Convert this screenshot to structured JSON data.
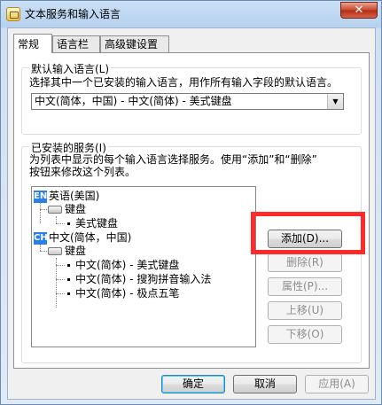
{
  "window": {
    "title": "文本服务和输入语言",
    "close_glyph": "✕"
  },
  "tabs": [
    {
      "label": "常规"
    },
    {
      "label": "语言栏"
    },
    {
      "label": "高级键设置"
    }
  ],
  "default_language": {
    "title": "默认输入语言(L)",
    "description": "选择其中一个已安装的输入语言，用作所有输入字段的默认语言。",
    "selected": "中文(简体，中国) - 中文(简体) - 美式键盘"
  },
  "installed_services": {
    "title": "已安装的服务(I)",
    "description_line1": "为列表中显示的每个输入语言选择服务。使用“添加”和“删除”",
    "description_line2": "按钮来修改这个列表。",
    "tree": {
      "lang1": {
        "badge": "EN",
        "label": "英语(美国)"
      },
      "lang1_group": "键盘",
      "lang1_item": "美式键盘",
      "lang2": {
        "badge": "CH",
        "label": "中文(简体，中国)"
      },
      "lang2_group": "键盘",
      "lang2_items": [
        "中文(简体) - 美式键盘",
        "中文(简体) - 搜狗拼音输入法",
        "中文(简体) - 极点五笔"
      ]
    }
  },
  "side_buttons": {
    "add": "添加(D)...",
    "remove": "删除(R)",
    "properties": "属性(P)...",
    "move_up": "上移(U)",
    "move_down": "下移(O)"
  },
  "footer": {
    "ok": "确定",
    "cancel": "取消",
    "apply": "应用(A)"
  },
  "colors": {
    "highlight": "#ff2a2a",
    "badge": "#2c7fe8"
  }
}
